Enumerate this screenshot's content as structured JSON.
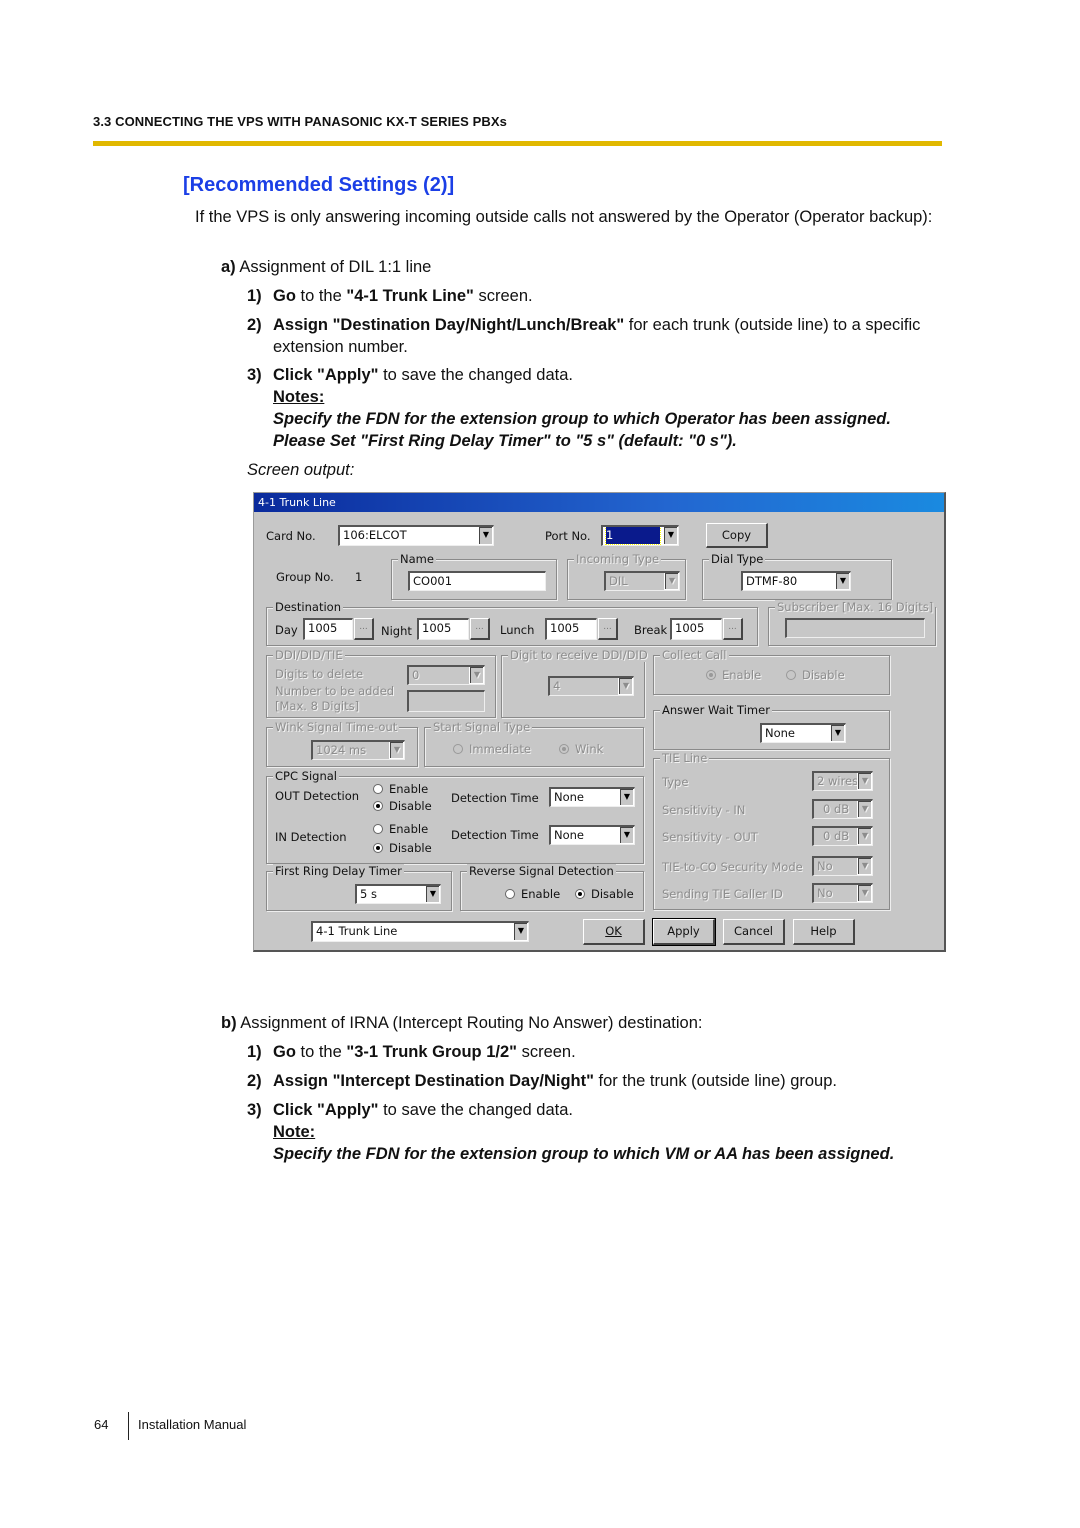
{
  "header": {
    "section": "3.3 CONNECTING THE VPS WITH PANASONIC KX-T SERIES PBXs",
    "rule_color": "#e1b800"
  },
  "title": {
    "text": "[Recommended Settings (2)]",
    "color": "#1b3fe6"
  },
  "intro": "If the VPS is only answering incoming outside calls not answered by the Operator (Operator backup):",
  "part_a": {
    "marker": "a)",
    "heading": "Assignment of DIL 1:1 line",
    "steps": [
      {
        "num": "1)",
        "bold1": "Go",
        "text1": " to the ",
        "bold2": "\"4-1 Trunk Line\"",
        "text2": " screen."
      },
      {
        "num": "2)",
        "bold1": "Assign \"Destination Day/Night/Lunch/Break\"",
        "text1": " for each trunk (outside line) to a specific extension number."
      },
      {
        "num": "3)",
        "bold1": "Click \"Apply\"",
        "text1": " to save the changed data."
      }
    ],
    "notes_label": "Notes:",
    "notes": [
      "Specify the FDN for the extension group to which Operator has been assigned.",
      "Please Set \"First Ring Delay Timer\" to \"5 s\" (default: \"0 s\")."
    ],
    "screen_output": "Screen output:"
  },
  "dialog": {
    "title": "4-1 Trunk Line",
    "card_no_label": "Card No.",
    "card_no_value": "106:ELCOT",
    "port_no_label": "Port No.",
    "port_no_value": "1",
    "copy_button": "Copy",
    "group_no_label": "Group No.",
    "group_no_value": "1",
    "name_group": "Name",
    "name_value": "CO001",
    "incoming_type_group": "Incoming Type",
    "incoming_type_value": "DIL",
    "dial_type_group": "Dial Type",
    "dial_type_value": "DTMF-80",
    "destination_group": "Destination",
    "day_label": "Day",
    "day_value": "1005",
    "night_label": "Night",
    "night_value": "1005",
    "lunch_label": "Lunch",
    "lunch_value": "1005",
    "break_label": "Break",
    "break_value": "1005",
    "ellipsis": "...",
    "subscriber_group": "Subscriber [Max. 16 Digits]",
    "subscriber_value": "",
    "ddi_group": "DDI/DID/TIE",
    "digits_delete_label": "Digits to delete",
    "digits_delete_value": "0",
    "number_added_label": "Number to be added",
    "number_added_label2": "[Max. 8 Digits]",
    "number_added_value": "",
    "digit_receive_group": "Digit to receive DDI/DID",
    "digit_receive_value": "4",
    "collect_call_group": "Collect Call",
    "collect_enable": "Enable",
    "collect_disable": "Disable",
    "answer_wait_group": "Answer Wait Timer",
    "answer_wait_value": "None",
    "wink_group": "Wink Signal Time-out",
    "wink_value": "1024 ms",
    "start_signal_group": "Start Signal Type",
    "start_immediate": "Immediate",
    "start_wink": "Wink",
    "cpc_group": "CPC Signal",
    "out_detection": "OUT Detection",
    "in_detection": "IN Detection",
    "enable": "Enable",
    "disable": "Disable",
    "detection_time": "Detection Time",
    "out_time_value": "None",
    "in_time_value": "None",
    "tie_group": "TIE Line",
    "tie_type_label": "Type",
    "tie_type_value": "2 wires",
    "sens_in_label": "Sensitivity - IN",
    "sens_in_value": "0 dB",
    "sens_out_label": "Sensitivity - OUT",
    "sens_out_value": "0 dB",
    "security_label": "TIE-to-CO Security Mode",
    "security_value": "No",
    "caller_id_label": "Sending TIE Caller ID",
    "caller_id_value": "No",
    "first_ring_group": "First Ring Delay Timer",
    "first_ring_value": "5 s",
    "reverse_group": "Reverse Signal Detection",
    "reverse_enable": "Enable",
    "reverse_disable": "Disable",
    "screen_select_value": "4-1 Trunk Line",
    "ok": "OK",
    "apply": "Apply",
    "cancel": "Cancel",
    "help": "Help"
  },
  "part_b": {
    "marker": "b)",
    "heading": "Assignment of IRNA (Intercept Routing No Answer) destination:",
    "steps": [
      {
        "num": "1)",
        "bold1": "Go",
        "text1": " to the ",
        "bold2": "\"3-1 Trunk Group 1/2\"",
        "text2": " screen."
      },
      {
        "num": "2)",
        "bold1": "Assign \"Intercept Destination Day/Night\"",
        "text1": " for the trunk (outside line) group."
      },
      {
        "num": "3)",
        "bold1": "Click \"Apply\"",
        "text1": " to save the changed data."
      }
    ],
    "note_label": "Note:",
    "note": "Specify the FDN for the extension group to which VM or AA has been assigned."
  },
  "footer": {
    "page": "64",
    "text": "Installation Manual"
  }
}
